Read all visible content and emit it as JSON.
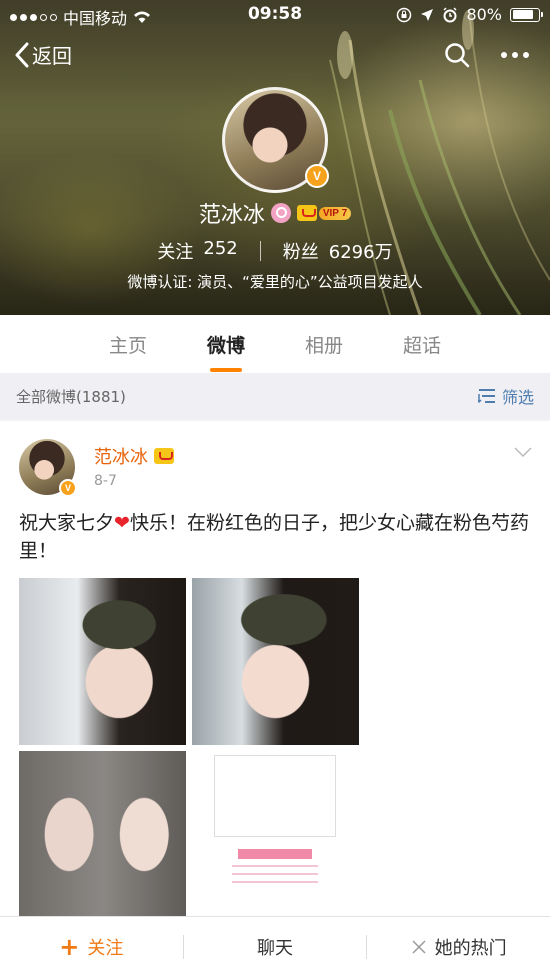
{
  "status_bar": {
    "carrier": "中国移动",
    "time": "09:58",
    "battery": "80%",
    "battery_level": 0.8
  },
  "nav": {
    "back_label": "返回"
  },
  "profile": {
    "name": "范冰冰",
    "vip_level": "VIP 7",
    "following_label": "关注",
    "following_count": "252",
    "followers_label": "粉丝",
    "followers_count": "6296万",
    "verification": "微博认证: 演员、“爱里的心”公益项目发起人"
  },
  "tabs": [
    {
      "label": "主页",
      "active": false
    },
    {
      "label": "微博",
      "active": true
    },
    {
      "label": "相册",
      "active": false
    },
    {
      "label": "超话",
      "active": false
    }
  ],
  "filter_bar": {
    "count_label": "全部微博(1881)",
    "filter_label": "筛选"
  },
  "post": {
    "author": "范冰冰",
    "date": "8-7",
    "text_before_heart": "祝大家七夕",
    "heart": "❤",
    "text_after_heart": "快乐！在粉红色的日子，把少女心藏在粉色芍药里！"
  },
  "bottom_bar": {
    "follow_label": "关注",
    "chat_label": "聊天",
    "hot_label": "她的热门"
  },
  "colors": {
    "accent": "#ff8200",
    "author": "#e8640c",
    "link": "#507daf",
    "verified": "#f7a21c"
  },
  "icons": [
    "signal-icon",
    "wifi-icon",
    "lock-rotation-icon",
    "location-icon",
    "alarm-icon",
    "battery-icon",
    "back-chevron-icon",
    "search-icon",
    "more-icon",
    "verified-icon",
    "vip-crown-icon",
    "filter-icon",
    "chevron-down-icon",
    "plus-icon",
    "hot-icon"
  ]
}
